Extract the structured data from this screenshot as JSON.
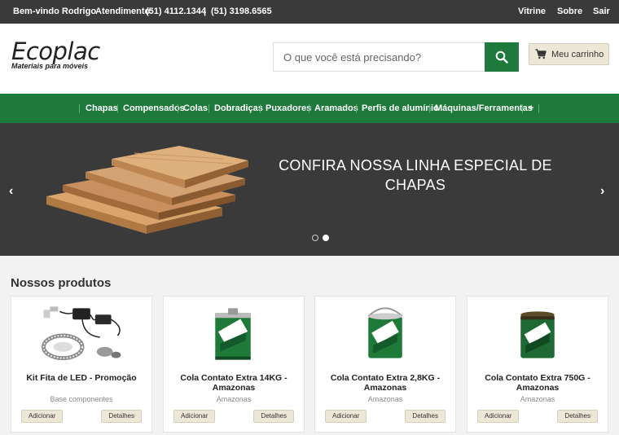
{
  "topbar": {
    "welcome": "Bem-vindo Rodrigo",
    "support_label": "Atendimento:",
    "phone1": "(51) 4112.1344",
    "separator": "|",
    "phone2": "(51) 3198.6565",
    "links": [
      "Vitrine",
      "Sobre",
      "Sair"
    ]
  },
  "header": {
    "logo_name": "Ecoplac",
    "logo_tagline": "Materiais para móveis",
    "search_placeholder": "O que você está precisando?",
    "cart_label": "Meu carrinho"
  },
  "categories": [
    "Chapas",
    "Compensados",
    "Colas",
    "Dobradiças",
    "Puxadores",
    "Aramados",
    "Perfis de alumínio",
    "Máquinas/Ferramentas",
    "+"
  ],
  "slider": {
    "text": "CONFIRA NOSSA LINHA ESPECIAL DE CHAPAS",
    "prev": "‹",
    "next": "›",
    "active_dot": 2,
    "dot_count": 2
  },
  "products_title": "Nossos produtos",
  "products": [
    {
      "name": "Kit Fita de LED - Promoção",
      "brand": "Base componentes",
      "add": "Adicionar",
      "details": "Detalhes"
    },
    {
      "name": "Cola Contato Extra 14KG - Amazonas",
      "brand": "Amazonas",
      "add": "Adicionar",
      "details": "Detalhes"
    },
    {
      "name": "Cola Contato Extra 2,8KG - Amazonas",
      "brand": "Amazonas",
      "add": "Adicionar",
      "details": "Detalhes"
    },
    {
      "name": "Cola Contato Extra 750G - Amazonas",
      "brand": "Amazonas",
      "add": "Adicionar",
      "details": "Detalhes"
    }
  ],
  "colors": {
    "brand_green": "#1e7a3a",
    "dark_bar": "#3a3a3a",
    "button_beige": "#ece7d6"
  }
}
